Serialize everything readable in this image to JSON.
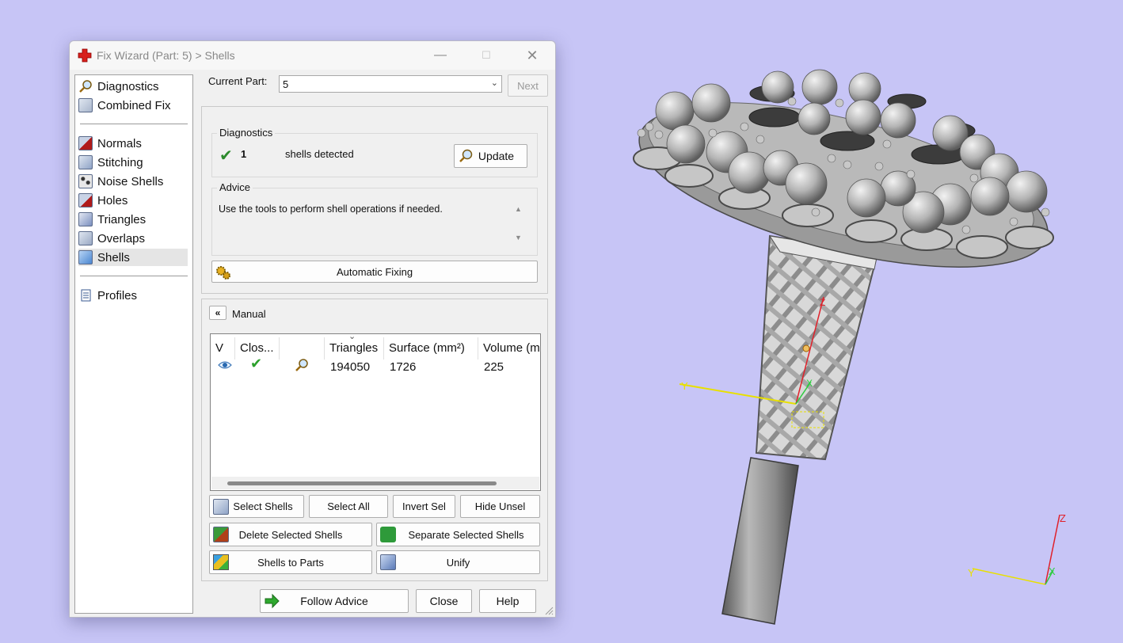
{
  "window": {
    "title": "Fix Wizard (Part: 5) > Shells",
    "minimize": "—",
    "maximize": "☐",
    "close": "✕"
  },
  "sidebar": {
    "items": [
      {
        "label": "Diagnostics",
        "icon": "magnifier-icon"
      },
      {
        "label": "Combined Fix",
        "icon": "combined-fix-icon"
      },
      {
        "label": "Normals",
        "icon": "normals-icon"
      },
      {
        "label": "Stitching",
        "icon": "stitching-icon"
      },
      {
        "label": "Noise Shells",
        "icon": "noise-shells-icon"
      },
      {
        "label": "Holes",
        "icon": "holes-icon"
      },
      {
        "label": "Triangles",
        "icon": "triangles-icon"
      },
      {
        "label": "Overlaps",
        "icon": "overlaps-icon"
      },
      {
        "label": "Shells",
        "icon": "shells-icon",
        "active": true
      },
      {
        "label": "Profiles",
        "icon": "profiles-icon"
      }
    ]
  },
  "current_part": {
    "label": "Current Part:",
    "value": "5",
    "next": "Next"
  },
  "diagnostics": {
    "title": "Diagnostics",
    "count": "1",
    "text": "shells detected",
    "update": "Update"
  },
  "advice": {
    "title": "Advice",
    "text": "Use the tools to perform shell operations if needed."
  },
  "automatic_fixing": "Automatic Fixing",
  "manual": {
    "title": "Manual",
    "collapse": "«"
  },
  "table": {
    "columns": [
      "V",
      "Clos...",
      "",
      "Triangles",
      "Surface (mm²)",
      "Volume (m"
    ],
    "rows": [
      {
        "visible": "eye-icon",
        "closed": "✔",
        "inspect": "magnifier-icon",
        "triangles": "194050",
        "surface": "1726",
        "volume": "225"
      }
    ]
  },
  "buttons": {
    "select_shells": "Select Shells",
    "select_all": "Select All",
    "invert_sel": "Invert Sel",
    "hide_unsel": "Hide Unsel",
    "delete_selected": "Delete Selected Shells",
    "separate_selected": "Separate Selected Shells",
    "shells_to_parts": "Shells to Parts",
    "unify": "Unify",
    "follow_advice": "Follow Advice",
    "close": "Close",
    "help": "Help"
  },
  "viewport": {
    "background": "#c7c5f6",
    "axis_labels": {
      "x": "X",
      "y": "Y",
      "z": "Z"
    },
    "axis_colors": {
      "x": "#2ecc40",
      "y": "#e8e000",
      "z": "#e0202a"
    }
  }
}
